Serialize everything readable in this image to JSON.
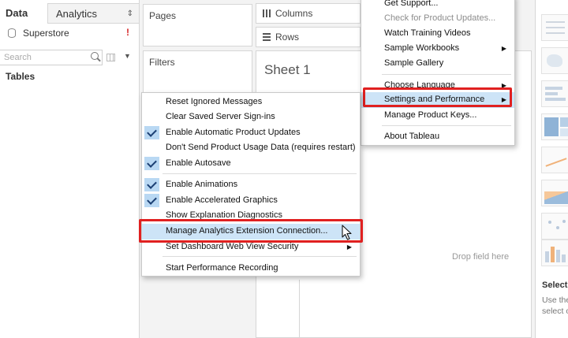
{
  "data_pane": {
    "tabs": [
      "Data",
      "Analytics"
    ],
    "analytics_chevron": "◆",
    "datasource": "Superstore",
    "datasource_warning": "!",
    "search_placeholder": "Search",
    "tables_heading": "Tables"
  },
  "cards": {
    "pages": "Pages",
    "filters": "Filters"
  },
  "shelves": {
    "columns": "Columns",
    "rows": "Rows"
  },
  "sheet": {
    "title": "Sheet 1",
    "drop_hint": "Drop field here"
  },
  "show_me": {
    "select_heading": "Select",
    "use_line1": "Use the",
    "use_line2": "select o"
  },
  "help_menu": {
    "items": [
      {
        "label": "Get Support...",
        "disabled": false
      },
      {
        "label": "Check for Product Updates...",
        "disabled": true
      },
      {
        "label": "Watch Training Videos",
        "disabled": false
      },
      {
        "label": "Sample Workbooks",
        "disabled": false,
        "submenu": true
      },
      {
        "label": "Sample Gallery",
        "disabled": false
      },
      {
        "label": "Choose Language",
        "disabled": false,
        "submenu": true
      },
      {
        "label": "Settings and Performance",
        "disabled": false,
        "submenu": true,
        "active": true
      },
      {
        "label": "Manage Product Keys...",
        "disabled": false
      },
      {
        "label": "About Tableau",
        "disabled": false
      }
    ]
  },
  "settings_submenu": {
    "items": [
      {
        "label": "Reset Ignored Messages",
        "checked": false
      },
      {
        "label": "Clear Saved Server Sign-ins",
        "checked": false
      },
      {
        "label": "Enable Automatic Product Updates",
        "checked": true
      },
      {
        "label": "Don't Send Product Usage Data (requires restart)",
        "checked": false
      },
      {
        "label": "Enable Autosave",
        "checked": true
      },
      {
        "label": "Enable Animations",
        "checked": true
      },
      {
        "label": "Enable Accelerated Graphics",
        "checked": true
      },
      {
        "label": "Show Explanation Diagnostics",
        "checked": false
      },
      {
        "label": "Manage Analytics Extension Connection...",
        "checked": false,
        "hover": true
      },
      {
        "label": "Set Dashboard Web View Security",
        "checked": false,
        "submenu": true
      },
      {
        "label": "Start Performance Recording",
        "checked": false
      }
    ]
  },
  "colors": {
    "highlight_box": "#e02020",
    "menu_hover": "#cde4f7",
    "check_bg": "#b9d8f3"
  }
}
